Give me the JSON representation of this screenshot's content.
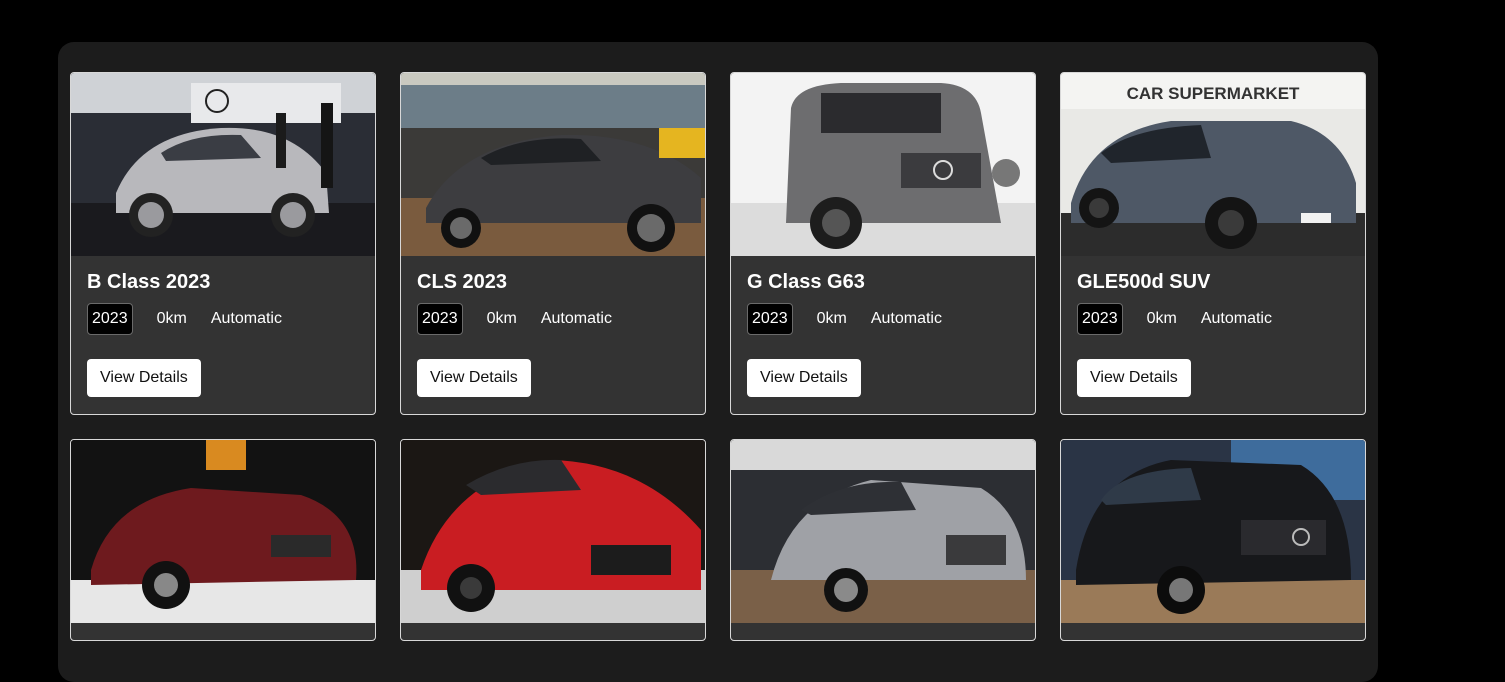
{
  "listings": [
    {
      "title": "B Class 2023",
      "year": "2023",
      "mileage": "0km",
      "transmission": "Automatic",
      "button": "View Details",
      "image": "silver-hatchback-showroom"
    },
    {
      "title": "CLS 2023",
      "year": "2023",
      "mileage": "0km",
      "transmission": "Automatic",
      "button": "View Details",
      "image": "dark-grey-coupe-showroom"
    },
    {
      "title": "G Class G63",
      "year": "2023",
      "mileage": "0km",
      "transmission": "Automatic",
      "button": "View Details",
      "image": "grey-suv-white-studio"
    },
    {
      "title": "GLE500d SUV",
      "year": "2023",
      "mileage": "0km",
      "transmission": "Automatic",
      "button": "View Details",
      "image": "blue-grey-suv-dealership",
      "sign": "CAR SUPERMARKET"
    }
  ],
  "second_row_images": [
    "red-convertible",
    "red-sports-coupe",
    "silver-sedan",
    "black-suv"
  ],
  "colors": {
    "page_bg": "#000000",
    "panel_bg": "#1c1c1c",
    "card_bg": "#333333",
    "button_bg": "#ffffff"
  }
}
